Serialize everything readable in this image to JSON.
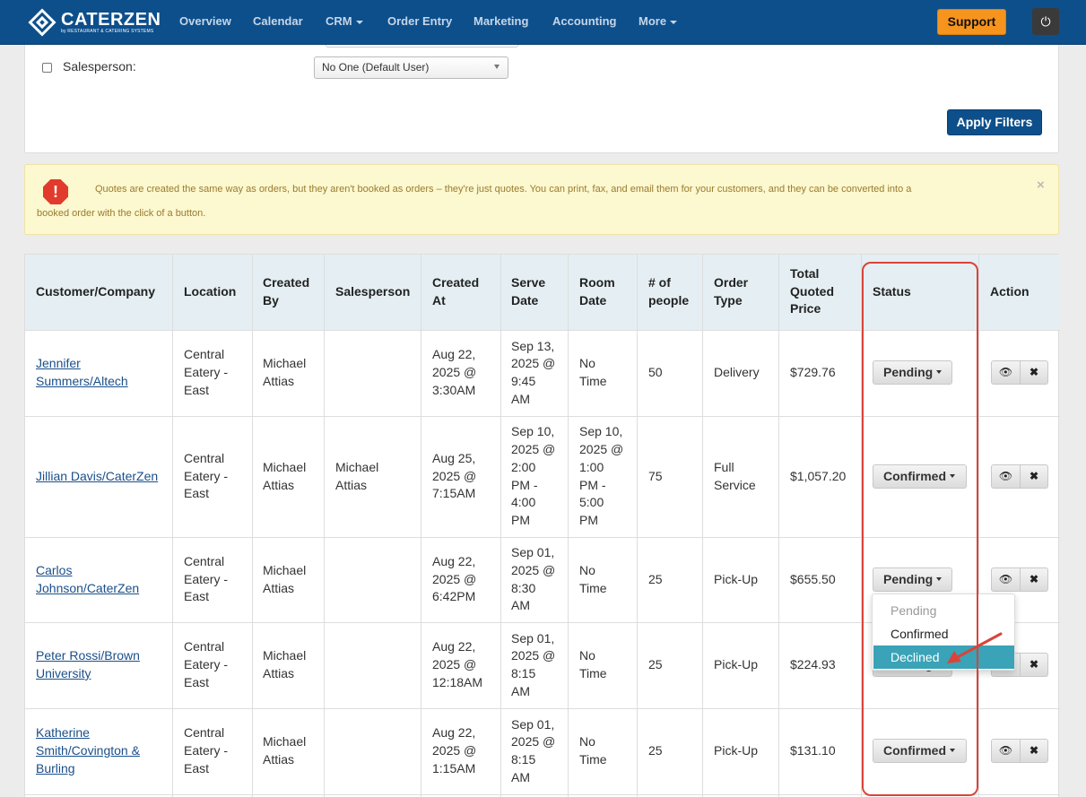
{
  "nav": {
    "brand": "CATERZEN",
    "brand_sub": "by RESTAURANT & CATERING SYSTEMS",
    "items": [
      "Overview",
      "Calendar",
      "CRM",
      "Order Entry",
      "Marketing",
      "Accounting",
      "More"
    ],
    "support": "Support"
  },
  "filters": {
    "salesperson_label": "Salesperson:",
    "salesperson_value": "No One (Default User)",
    "apply": "Apply Filters"
  },
  "alert": {
    "line1": "Quotes are created the same way as orders, but they aren't booked as orders – they're just quotes. You can print, fax, and email them for your customers, and they can be converted into a",
    "line2": "booked order with the click of a button.",
    "close": "×"
  },
  "table": {
    "headers": {
      "customer": "Customer/Company",
      "location": "Location",
      "created_by": [
        "Created",
        "By"
      ],
      "salesperson": "Salesperson",
      "created_at": [
        "Created",
        "At"
      ],
      "serve_date": [
        "Serve",
        "Date"
      ],
      "room_date": [
        "Room",
        "Date"
      ],
      "people": [
        "# of",
        "people"
      ],
      "order_type": [
        "Order",
        "Type"
      ],
      "total": [
        "Total",
        "Quoted",
        "Price"
      ],
      "status": "Status",
      "action": "Action"
    },
    "rows": [
      {
        "customer": [
          "Jennifer",
          "Summers/Altech"
        ],
        "location": [
          "Central",
          "Eatery -",
          "East"
        ],
        "created_by": [
          "Michael",
          "Attias"
        ],
        "salesperson": [],
        "created_at": [
          "Aug 22,",
          "2025 @",
          "3:30AM"
        ],
        "serve_date": [
          "Sep 13,",
          "2025 @",
          "9:45",
          "AM"
        ],
        "room_date": [
          "No",
          "Time"
        ],
        "people": "50",
        "order_type": [
          "Delivery"
        ],
        "total": "$729.76",
        "status": "Pending"
      },
      {
        "customer": [
          "Jillian Davis/CaterZen"
        ],
        "location": [
          "Central",
          "Eatery -",
          "East"
        ],
        "created_by": [
          "Michael",
          "Attias"
        ],
        "salesperson": [
          "Michael",
          "Attias"
        ],
        "created_at": [
          "Aug 25,",
          "2025 @",
          "7:15AM"
        ],
        "serve_date": [
          "Sep 10,",
          "2025 @",
          "2:00",
          "PM -",
          "4:00",
          "PM"
        ],
        "room_date": [
          "Sep 10,",
          "2025 @",
          "1:00",
          "PM -",
          "5:00",
          "PM"
        ],
        "people": "75",
        "order_type": [
          "Full",
          "Service"
        ],
        "total": "$1,057.20",
        "status": "Confirmed"
      },
      {
        "customer": [
          "Carlos",
          "Johnson/CaterZen"
        ],
        "location": [
          "Central",
          "Eatery -",
          "East"
        ],
        "created_by": [
          "Michael",
          "Attias"
        ],
        "salesperson": [],
        "created_at": [
          "Aug 22,",
          "2025 @",
          "6:42PM"
        ],
        "serve_date": [
          "Sep 01,",
          "2025 @",
          "8:30",
          "AM"
        ],
        "room_date": [
          "No",
          "Time"
        ],
        "people": "25",
        "order_type": [
          "Pick-Up"
        ],
        "total": "$655.50",
        "status": "Pending"
      },
      {
        "customer": [
          "Peter Rossi/Brown",
          "University"
        ],
        "location": [
          "Central",
          "Eatery -",
          "East"
        ],
        "created_by": [
          "Michael",
          "Attias"
        ],
        "salesperson": [],
        "created_at": [
          "Aug 22,",
          "2025 @",
          "12:18AM"
        ],
        "serve_date": [
          "Sep 01,",
          "2025 @",
          "8:15",
          "AM"
        ],
        "room_date": [
          "No",
          "Time"
        ],
        "people": "25",
        "order_type": [
          "Pick-Up"
        ],
        "total": "$224.93",
        "status": "Pending"
      },
      {
        "customer": [
          "Katherine",
          "Smith/Covington &",
          "Burling"
        ],
        "location": [
          "Central",
          "Eatery -",
          "East"
        ],
        "created_by": [
          "Michael",
          "Attias"
        ],
        "salesperson": [],
        "created_at": [
          "Aug 22,",
          "2025 @",
          "1:15AM"
        ],
        "serve_date": [
          "Sep 01,",
          "2025 @",
          "8:15",
          "AM"
        ],
        "room_date": [
          "No",
          "Time"
        ],
        "people": "25",
        "order_type": [
          "Pick-Up"
        ],
        "total": "$131.10",
        "status": "Confirmed"
      }
    ],
    "status_menu": {
      "options": [
        "Pending",
        "Confirmed",
        "Declined"
      ],
      "disabled": "Pending",
      "highlighted": "Declined"
    }
  },
  "icons": {
    "logo": "caterzen-logo-icon",
    "power": "power-icon",
    "alert": "stop-alert-icon",
    "view": "eye-icon",
    "delete": "close-icon"
  },
  "colors": {
    "navbar": "#0d4f8b",
    "support": "#f7941d",
    "apply": "#0d4f8b",
    "alert_bg": "#fcf8cf",
    "table_head": "#e5eff3",
    "link": "#1a4f8a",
    "dropdown_active": "#3aa3b7",
    "annotation": "#d9443a"
  }
}
